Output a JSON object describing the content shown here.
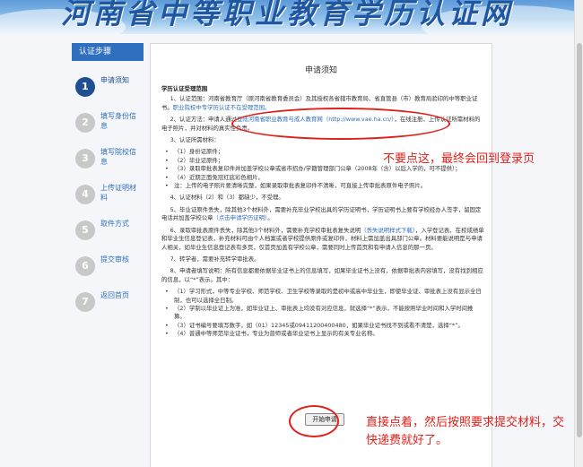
{
  "banner": {
    "title": "河南省中等职业教育学历认证网"
  },
  "sidebar": {
    "header": "认证步骤",
    "steps": [
      {
        "num": "1",
        "label": "申请须知"
      },
      {
        "num": "2",
        "label": "填写身份信息"
      },
      {
        "num": "3",
        "label": "填写院校信息"
      },
      {
        "num": "4",
        "label": "上传证明材料"
      },
      {
        "num": "5",
        "label": "取件方式"
      },
      {
        "num": "6",
        "label": "提交审核"
      },
      {
        "num": "7",
        "label": "返回首页"
      }
    ]
  },
  "panel": {
    "title": "申请须知",
    "section_head": "学历认证受理范围",
    "p1a": "1、认证范围：河南省教育厅（原河南省教育委员会）及其授权各省辖市教育局、省直管县（市）教育局验印的中等职业证书。",
    "p1b": "职业院校中专学历认证不在受理范围。",
    "p2a": "2、认证方法：申请人通过",
    "p2b": "登陆河南省职业教育与成人教育网（http://www.vae.ha.cn/）",
    "p2c": "，在线注册、上传认证所需材料的电子照片，并对材料的真实性负责。",
    "p3": "3、认证所需材料：",
    "materials": [
      "（1）身份证原件；",
      "（2）毕业证原件；",
      "（3）录取审批表复印件并加盖学校公章或省市招办/学籍管理部门公章（2008年（含）以后入学的，可不提供）；",
      "（4）近期正面免冠红底彩色相片。",
      "注：上传的电子照片要清晰完整，如果录取审批表复印件不清晰，可直接上传审批表原件电子照片。"
    ],
    "p4": "4、认证材料（2）和（3）都缺少，不受理。",
    "p5a": "5、毕业证原件丢失，除其他3个材料外，需要补充毕业学校出具的学历证明书，学历证明书上要有学校经办人签字，留固定电话并加盖学校公章",
    "p5b": "（点击申请学历证明）",
    "p5c": "。",
    "p6a": "6、录取审批表原件丢失，除其他3个材料外，需要补充学校审批表复失说明",
    "p6b": "（丢失说明样式下载）",
    "p6c": "，入学登记表、在校成绩单和毕业生信息登记表，补充材料可由个人档案或者学校提供原件或复印件，材料上需加盖出具部门公章。材料要能说明是与申请人相关，如毕业生信息登记表有多页，仅首页加盖有学校公章，需要同时上传首页和有申请人信息的那一页。",
    "p7": "7、转学者，需要补充转学审批表。",
    "p8": "8、申请者填写说明：所有信息都要依据毕业证书上的信息填写，如果毕业证书上没有，依据审批表内容填写，没有找到相应的信息，以“*”表示。其中：",
    "notes": [
      "（1）学习形式，中等专业学校、师范学校、卫生学校等录取的是初中或高中毕业生，即使毕业证、审批表上没有显示全日制，也可以选择全日制。",
      "（2）学制以毕业证上为准，如毕业证上、审批表上均没有对应信息，就选择“*”表示，不能按照毕业时间和入学时间推算。",
      "（3）证书编号要填写数字，如（01）12345或09411200400480，如果毕业证书找不到或看不清楚，选择“*”。",
      "（4）普通中等师范毕业证书，专业为普师或者毕业证书上显示的有关专业名称。"
    ],
    "start_button": "开始申请"
  },
  "annotations": {
    "top": "不要点这，最终会回到登录页",
    "bottom": "直接点着，然后按照要求提交材料，交快递费就好了。"
  },
  "colors": {
    "accent": "#2f6fbf",
    "annotation": "#e0201a",
    "active_step": "#1f4f91"
  }
}
